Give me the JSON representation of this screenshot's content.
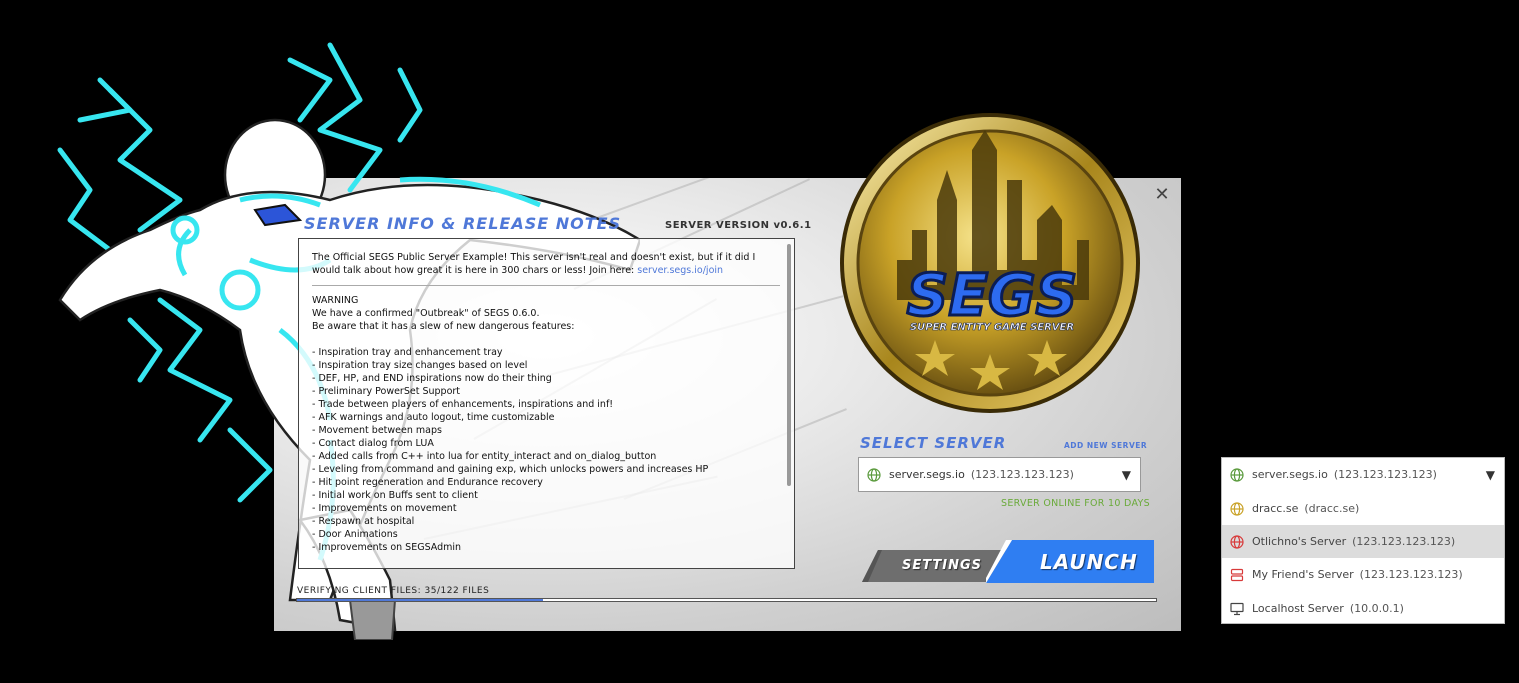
{
  "window": {
    "close_label": "✕"
  },
  "info": {
    "title": "Server Info & Release Notes",
    "server_version": "SERVER VERSION v0.6.1"
  },
  "notes": {
    "intro": "The Official SEGS Public Server Example! This server isn't real and doesn't exist, but if it did I would talk about how great it is here in 300 chars or less! Join here: ",
    "link_text": "server.segs.io/join",
    "lines": [
      "WARNING",
      "We have a confirmed \"Outbreak\" of SEGS 0.6.0.",
      "Be aware that it has a slew of new dangerous features:",
      "",
      "- Inspiration tray and enhancement tray",
      "- Inspiration tray size changes based on level",
      "- DEF, HP, and END inspirations now do their thing",
      "- Preliminary PowerSet Support",
      "- Trade between players of enhancements, inspirations and inf!",
      "- AFK warnings and auto logout, time customizable",
      "- Movement between maps",
      "- Contact dialog from LUA",
      "- Added calls from C++ into lua for entity_interact and on_dialog_button",
      "- Leveling from command and gaining exp, which unlocks powers and increases HP",
      "- Hit point regeneration and Endurance recovery",
      "- Initial work on Buffs sent to client",
      "- Improvements on movement",
      "- Respawn at hospital",
      "- Door Animations",
      "- Improvements on SEGSAdmin"
    ]
  },
  "verify": {
    "label": "VERIFYING CLIENT FILES: 35/122 FILES",
    "progress_fraction": 0.2868
  },
  "logo": {
    "title": "SEGS",
    "subtitle": "SUPER ENTITY GAME SERVER"
  },
  "select_server": {
    "title": "Select Server",
    "add_label": "ADD NEW SERVER",
    "selected": {
      "name": "server.segs.io",
      "address": "(123.123.123.123)",
      "icon": "globe-icon"
    },
    "caret": "▼",
    "status": "SERVER ONLINE FOR 10 DAYS"
  },
  "buttons": {
    "settings": "Settings",
    "launch": "Launch"
  },
  "dropdown": {
    "items": [
      {
        "name": "server.segs.io",
        "address": "(123.123.123.123)",
        "icon": "globe-icon",
        "color": "#5a9a3c"
      },
      {
        "name": "dracc.se",
        "address": "(dracc.se)",
        "icon": "globe-icon",
        "color": "#c9a227"
      },
      {
        "name": "Otlichno's Server",
        "address": "(123.123.123.123)",
        "icon": "globe-icon",
        "color": "#d83a3a"
      },
      {
        "name": "My Friend's Server",
        "address": "(123.123.123.123)",
        "icon": "server-icon",
        "color": "#d83a3a"
      },
      {
        "name": "Localhost Server",
        "address": "(10.0.0.1)",
        "icon": "monitor-icon",
        "color": "#444444"
      }
    ],
    "caret": "▼"
  },
  "colors": {
    "accent": "#4f78d8",
    "online": "#6aaa3a",
    "gold": "#c9a227"
  }
}
